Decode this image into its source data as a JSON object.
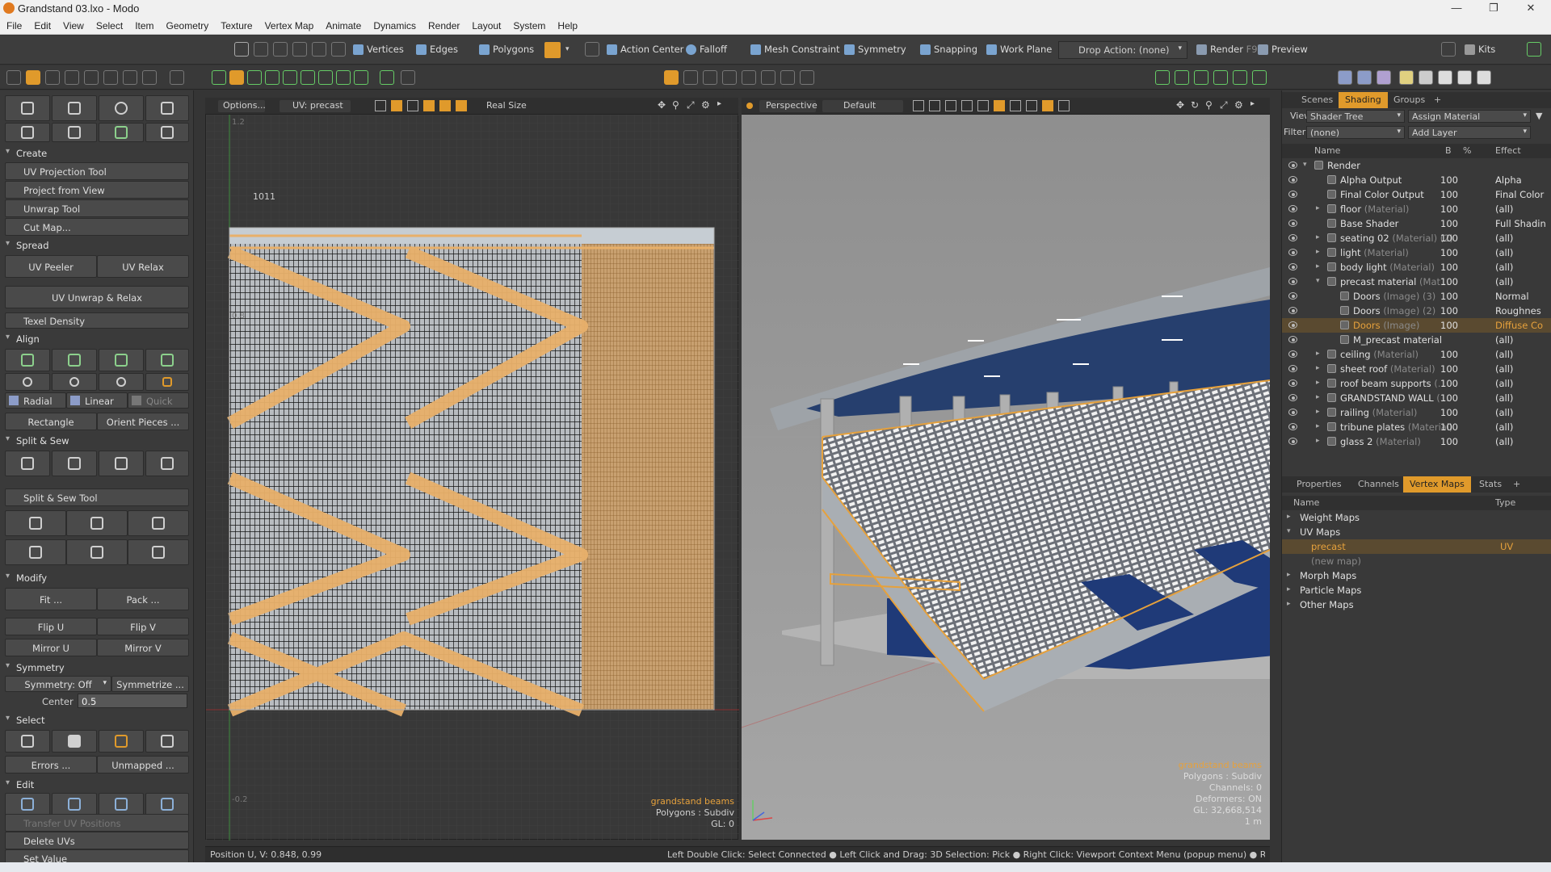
{
  "window": {
    "title": "Grandstand 03.lxo - Modo"
  },
  "menu": [
    "File",
    "Edit",
    "View",
    "Select",
    "Item",
    "Geometry",
    "Texture",
    "Vertex Map",
    "Animate",
    "Dynamics",
    "Render",
    "Layout",
    "System",
    "Help"
  ],
  "toolbar1": {
    "vertices": "Vertices",
    "edges": "Edges",
    "polygons": "Polygons",
    "action_center": "Action Center",
    "falloff": "Falloff",
    "mesh_constraint": "Mesh Constraint",
    "symmetry": "Symmetry",
    "snapping": "Snapping",
    "work_plane": "Work Plane",
    "drop_action": "Drop Action: (none)",
    "render": "Render",
    "render_key": "F9",
    "preview": "Preview",
    "kits": "Kits"
  },
  "left": {
    "create_hdr": "Create",
    "uv_projection_tool": "UV Projection Tool",
    "project_from_view": "Project from View",
    "unwrap_tool": "Unwrap Tool",
    "cut_map": "Cut Map...",
    "spread_hdr": "Spread",
    "uv_peeler": "UV Peeler",
    "uv_relax": "UV Relax",
    "uv_unwrap_relax": "UV Unwrap & Relax",
    "texel_density": "Texel Density",
    "align_hdr": "Align",
    "radial": "Radial",
    "linear": "Linear",
    "quick": "Quick",
    "rectangle": "Rectangle",
    "orient_pieces": "Orient Pieces ...",
    "split_sew_hdr": "Split & Sew",
    "split_sew_tool": "Split & Sew Tool",
    "modify_hdr": "Modify",
    "fit": "Fit ...",
    "pack": "Pack ...",
    "flip_u": "Flip U",
    "flip_v": "Flip V",
    "mirror_u": "Mirror U",
    "mirror_v": "Mirror V",
    "symmetry_hdr": "Symmetry",
    "symmetry_off": "Symmetry: Off",
    "symmetrize": "Symmetrize ...",
    "center_label": "Center",
    "center_value": "0.5",
    "select_hdr": "Select",
    "errors": "Errors ...",
    "unmapped": "Unmapped ...",
    "edit_hdr": "Edit",
    "transfer_uv": "Transfer UV Positions",
    "delete_uvs": "Delete UVs",
    "set_value": "Set Value"
  },
  "uv": {
    "options": "Options...",
    "map": "UV: precast",
    "real_size": "Real Size",
    "tile": "1011",
    "tick_top": "1.2",
    "tick_mid": "0.8",
    "tick_bot": "-0.2",
    "info_item": "grandstand beams",
    "info_poly": "Polygons : Subdiv",
    "info_gl": "GL: 0"
  },
  "vp3d": {
    "view": "Perspective",
    "style": "Default",
    "info_item": "grandstand beams",
    "info_poly": "Polygons : Subdiv",
    "info_channels": "Channels: 0",
    "info_deformers": "Deformers: ON",
    "info_gl": "GL: 32,668,514",
    "info_scale": "1 m"
  },
  "right": {
    "tabs": [
      "Scenes",
      "Shading",
      "Groups",
      "+"
    ],
    "view_label": "View",
    "view_value": "Shader Tree",
    "assign": "Assign Material",
    "filter_label": "Filter",
    "filter_value": "(none)",
    "add_layer": "Add Layer",
    "cols": {
      "name": "Name",
      "b": "B",
      "pct": "%",
      "effect": "Effect"
    },
    "rows": [
      {
        "name": "Render",
        "sub": "",
        "pct": "",
        "eff": "",
        "indent": 0,
        "tri": "▾"
      },
      {
        "name": "Alpha Output",
        "sub": "",
        "pct": "100",
        "eff": "Alpha",
        "indent": 1,
        "tri": ""
      },
      {
        "name": "Final Color Output",
        "sub": "",
        "pct": "100",
        "eff": "Final Color",
        "indent": 1,
        "tri": ""
      },
      {
        "name": "floor",
        "sub": "(Material)",
        "pct": "100",
        "eff": "(all)",
        "indent": 1,
        "tri": "▸"
      },
      {
        "name": "Base Shader",
        "sub": "",
        "pct": "100",
        "eff": "Full Shadin",
        "indent": 1,
        "tri": ""
      },
      {
        "name": "seating 02",
        "sub": "(Material) (2)",
        "pct": "100",
        "eff": "(all)",
        "indent": 1,
        "tri": "▸"
      },
      {
        "name": "light",
        "sub": "(Material)",
        "pct": "100",
        "eff": "(all)",
        "indent": 1,
        "tri": "▸"
      },
      {
        "name": "body light",
        "sub": "(Material)",
        "pct": "100",
        "eff": "(all)",
        "indent": 1,
        "tri": "▸"
      },
      {
        "name": "precast material",
        "sub": "(Mat...",
        "pct": "100",
        "eff": "(all)",
        "indent": 1,
        "tri": "▾"
      },
      {
        "name": "Doors",
        "sub": "(Image) (3)",
        "pct": "100",
        "eff": "Normal",
        "indent": 2,
        "tri": ""
      },
      {
        "name": "Doors",
        "sub": "(Image) (2)",
        "pct": "100",
        "eff": "Roughnes",
        "indent": 2,
        "tri": ""
      },
      {
        "name": "Doors",
        "sub": "(Image)",
        "pct": "100",
        "eff": "Diffuse Co",
        "indent": 2,
        "tri": "",
        "sel": true
      },
      {
        "name": "M_precast material",
        "sub": "",
        "pct": "",
        "eff": "(all)",
        "indent": 2,
        "tri": ""
      },
      {
        "name": "ceiling",
        "sub": "(Material)",
        "pct": "100",
        "eff": "(all)",
        "indent": 1,
        "tri": "▸"
      },
      {
        "name": "sheet roof",
        "sub": "(Material)",
        "pct": "100",
        "eff": "(all)",
        "indent": 1,
        "tri": "▸"
      },
      {
        "name": "roof beam supports",
        "sub": "(...",
        "pct": "100",
        "eff": "(all)",
        "indent": 1,
        "tri": "▸"
      },
      {
        "name": "GRANDSTAND WALL",
        "sub": "(...",
        "pct": "100",
        "eff": "(all)",
        "indent": 1,
        "tri": "▸"
      },
      {
        "name": "railing",
        "sub": "(Material)",
        "pct": "100",
        "eff": "(all)",
        "indent": 1,
        "tri": "▸"
      },
      {
        "name": "tribune plates",
        "sub": "(Material)",
        "pct": "100",
        "eff": "(all)",
        "indent": 1,
        "tri": "▸"
      },
      {
        "name": "glass 2",
        "sub": "(Material)",
        "pct": "100",
        "eff": "(all)",
        "indent": 1,
        "tri": "▸"
      }
    ],
    "tabs2": [
      "Properties",
      "Channels",
      "Vertex Maps",
      "Stats",
      "+"
    ],
    "vm_cols": {
      "name": "Name",
      "type": "Type"
    },
    "vm_rows": [
      {
        "name": "Weight Maps",
        "tri": "▸",
        "type": "",
        "indent": 0
      },
      {
        "name": "UV Maps",
        "tri": "▾",
        "type": "",
        "indent": 0
      },
      {
        "name": "precast",
        "tri": "",
        "type": "UV",
        "indent": 1,
        "sel": true
      },
      {
        "name": "(new map)",
        "tri": "",
        "type": "",
        "indent": 1,
        "dim": true
      },
      {
        "name": "Morph Maps",
        "tri": "▸",
        "type": "",
        "indent": 0
      },
      {
        "name": "Particle Maps",
        "tri": "▸",
        "type": "",
        "indent": 0
      },
      {
        "name": "Other Maps",
        "tri": "▸",
        "type": "",
        "indent": 0
      }
    ]
  },
  "status": {
    "position": "Position U, V:  0.848, 0.99",
    "hint": "Left Double Click: Select Connected ● Left Click and Drag: 3D Selection: Pick ● Right Click: Viewport Context Menu (popup menu) ● Right Click and Dra..."
  },
  "colors": {
    "accent": "#e09a2b",
    "uv_wire": "#e8b06a",
    "selection": "#e6a13c"
  }
}
